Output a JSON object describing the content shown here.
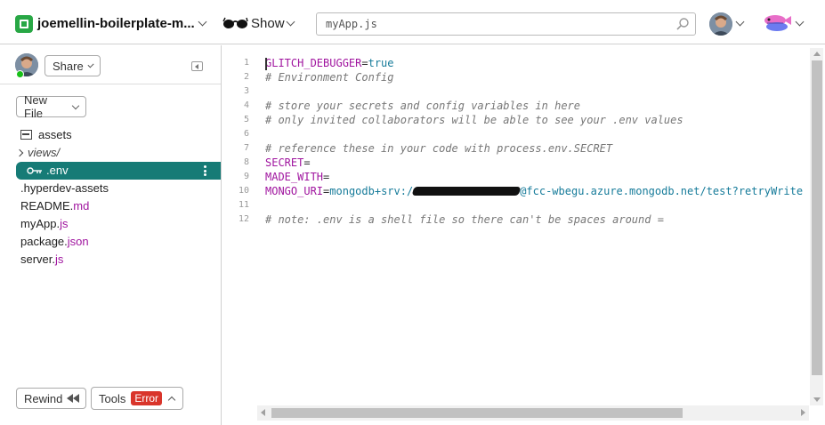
{
  "header": {
    "project_name": "joemellin-boilerplate-m...",
    "show_label": "Show",
    "search_value": "myApp.js"
  },
  "sidebar": {
    "share_label": "Share",
    "new_file_label": "New File",
    "files": [
      {
        "name": "assets",
        "ext": "",
        "type": "assets"
      },
      {
        "name": "views/",
        "ext": "",
        "type": "folder"
      },
      {
        "name": ".env",
        "ext": "",
        "type": "env",
        "selected": true
      },
      {
        "name": ".hyperdev-assets",
        "ext": "",
        "type": "file"
      },
      {
        "name": "README.",
        "ext": "md",
        "type": "file"
      },
      {
        "name": "myApp.",
        "ext": "js",
        "type": "file"
      },
      {
        "name": "package.",
        "ext": "json",
        "type": "file"
      },
      {
        "name": "server.",
        "ext": "js",
        "type": "file"
      }
    ],
    "rewind_label": "Rewind",
    "tools_label": "Tools",
    "error_badge": "Error"
  },
  "editor": {
    "lines": [
      {
        "num": "1",
        "var": "GLITCH_DEBUGGER",
        "op": "=",
        "val": "true"
      },
      {
        "num": "2",
        "comment": "# Environment Config"
      },
      {
        "num": "3"
      },
      {
        "num": "4",
        "comment": "# store your secrets and config variables in here"
      },
      {
        "num": "5",
        "comment": "# only invited collaborators will be able to see your .env values"
      },
      {
        "num": "6"
      },
      {
        "num": "7",
        "comment": "# reference these in your code with process.env.SECRET"
      },
      {
        "num": "8",
        "var": "SECRET",
        "op": "=",
        "val": ""
      },
      {
        "num": "9",
        "var": "MADE_WITH",
        "op": "=",
        "val": ""
      },
      {
        "num": "10",
        "var": "MONGO_URI",
        "op": "=",
        "val": "mongodb+srv:/",
        "redacted": true,
        "val2": "@fcc-wbegu.azure.mongodb.net/test?retryWrite"
      },
      {
        "num": "11"
      },
      {
        "num": "12",
        "comment": "# note: .env is a shell file so there can't be spaces around ="
      }
    ]
  },
  "colors": {
    "accent": "#167b76",
    "error": "#d9352b",
    "glitch_green": "#28a745",
    "env_var": "#a0159f"
  }
}
